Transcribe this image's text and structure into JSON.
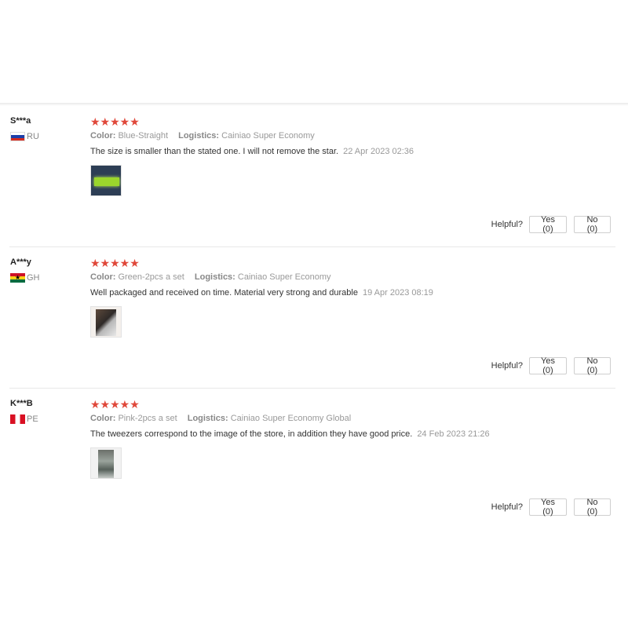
{
  "helpful_label": "Helpful?",
  "star_glyphs": "★★★★★",
  "colors": {
    "star": "#e0483a",
    "meta_gray": "#999999",
    "divider": "#e8e8e8"
  },
  "reviews": [
    {
      "user": "S***a",
      "country": "RU",
      "rating": 5,
      "color_label": "Color:",
      "color_value": "Blue-Straight",
      "logistics_label": "Logistics:",
      "logistics_value": "Cainiao Super Economy",
      "text": "The size is smaller than the stated one. I will not remove the star.",
      "date": "22 Apr 2023 02:36",
      "yes_label": "Yes (0)",
      "no_label": "No (0)"
    },
    {
      "user": "A***y",
      "country": "GH",
      "rating": 5,
      "color_label": "Color:",
      "color_value": "Green-2pcs a set",
      "logistics_label": "Logistics:",
      "logistics_value": "Cainiao Super Economy",
      "text": "Well packaged and received on time. Material very strong and durable",
      "date": "19 Apr 2023 08:19",
      "yes_label": "Yes (0)",
      "no_label": "No (0)"
    },
    {
      "user": "K***B",
      "country": "PE",
      "rating": 5,
      "color_label": "Color:",
      "color_value": "Pink-2pcs a set",
      "logistics_label": "Logistics:",
      "logistics_value": "Cainiao Super Economy Global",
      "text": "The tweezers correspond to the image of the store, in addition they have good price.",
      "date": "24 Feb 2023 21:26",
      "yes_label": "Yes (0)",
      "no_label": "No (0)"
    }
  ]
}
